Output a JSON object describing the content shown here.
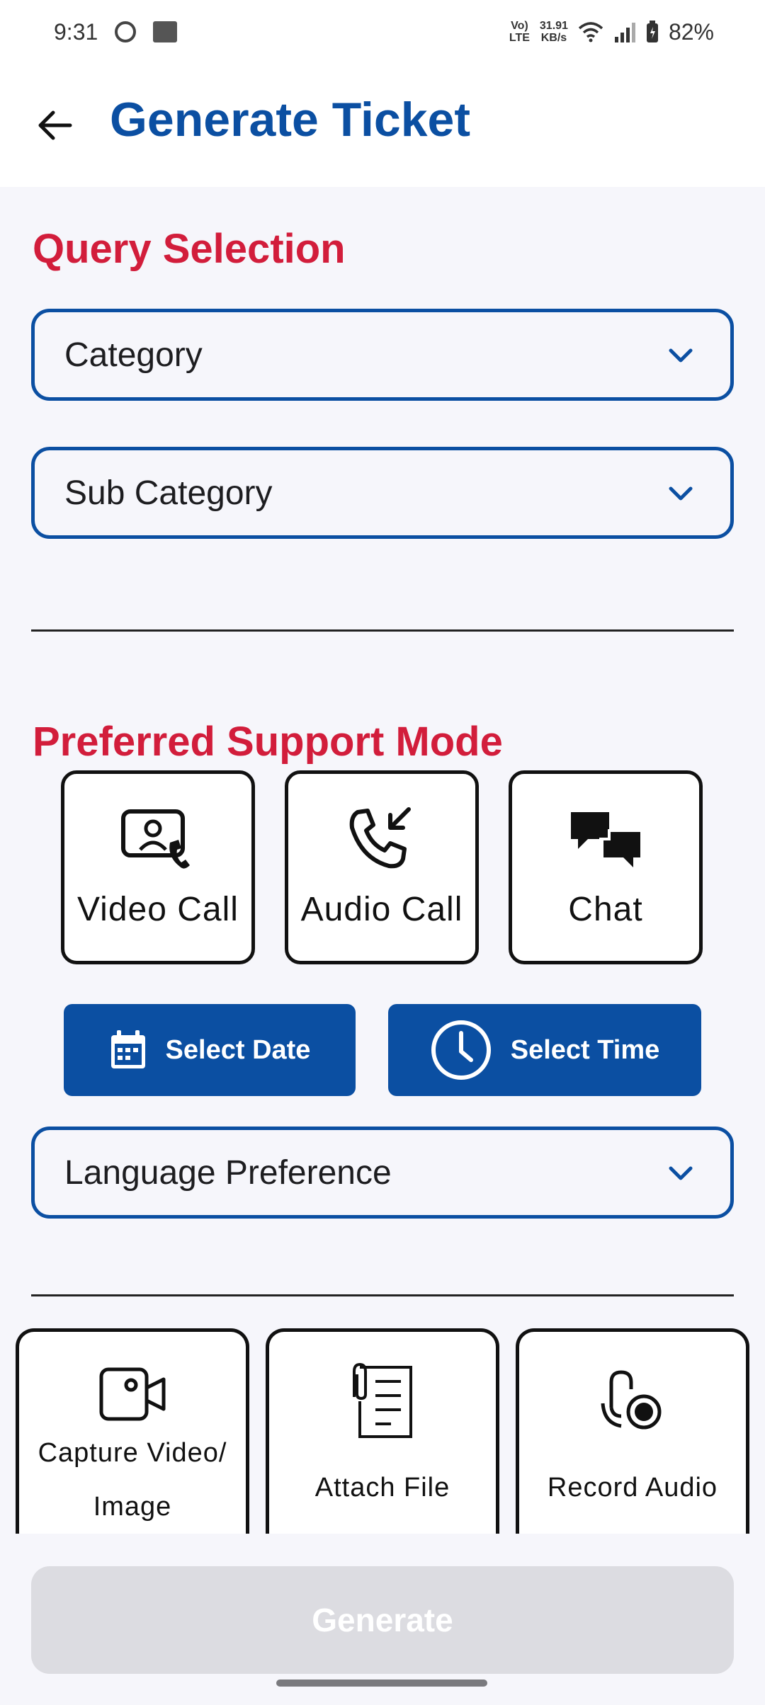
{
  "status_bar": {
    "time": "9:31",
    "volte_top": "Vo)",
    "volte_bottom": "LTE",
    "speed_top": "31.91",
    "speed_bottom": "KB/s",
    "battery": "82%",
    "icons": [
      "face-icon",
      "app-badge-icon",
      "volte-icon",
      "wifi-icon",
      "signal-icon",
      "battery-icon"
    ]
  },
  "app_bar": {
    "title": "Generate Ticket",
    "back_icon": "arrow-left-icon"
  },
  "query_selection": {
    "title": "Query Selection",
    "category": "Category",
    "sub_category": "Sub Category"
  },
  "support_mode": {
    "title": "Preferred Support Mode",
    "modes": [
      {
        "label": "Video Call",
        "icon": "video-call-icon"
      },
      {
        "label": "Audio Call",
        "icon": "audio-call-icon"
      },
      {
        "label": "Chat",
        "icon": "chat-icon"
      }
    ],
    "select_date": "Select Date",
    "select_time": "Select Time",
    "language": "Language Preference"
  },
  "attachments": [
    {
      "label_line1": "Capture Video/",
      "label_line2": "Image",
      "icon": "camera-icon"
    },
    {
      "label": "Attach File",
      "icon": "attach-file-icon"
    },
    {
      "label": "Record Audio",
      "icon": "record-audio-icon"
    }
  ],
  "generate_label": "Generate",
  "colors": {
    "brand_blue": "#0b4fa2",
    "accent_red": "#d21d3b",
    "disabled_grey": "#dcdce1"
  }
}
